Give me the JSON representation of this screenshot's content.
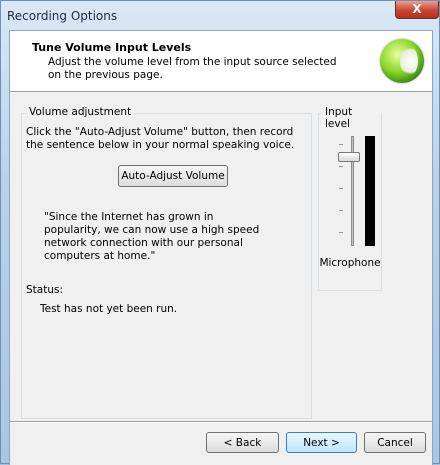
{
  "window": {
    "title": "Recording Options",
    "close_glyph": "X"
  },
  "header": {
    "title": "Tune Volume Input Levels",
    "subtitle": "Adjust the volume level from the input source selected on the previous page.",
    "logo_icon": "speech-recognition-logo-icon"
  },
  "volume_adjustment": {
    "label": "Volume adjustment",
    "instructions": "Click the \"Auto-Adjust Volume\" button, then record the sentence below in your normal speaking voice.",
    "auto_adjust_label": "Auto-Adjust Volume",
    "sentence": "\"Since the Internet has grown in popularity, we can now use a high speed network connection with our personal computers at home.\"",
    "status_label": "Status:",
    "status_value": "Test has not yet been run."
  },
  "input_level": {
    "label": "Input level",
    "source": "Microphone",
    "slider_level": 0.84,
    "meter_level": 0.0
  },
  "footer": {
    "back_label": "< Back",
    "next_label": "Next >",
    "cancel_label": "Cancel"
  },
  "colors": {
    "accent": "#3c7fb1",
    "close": "#c9452f",
    "meter_bg": "#000000"
  }
}
